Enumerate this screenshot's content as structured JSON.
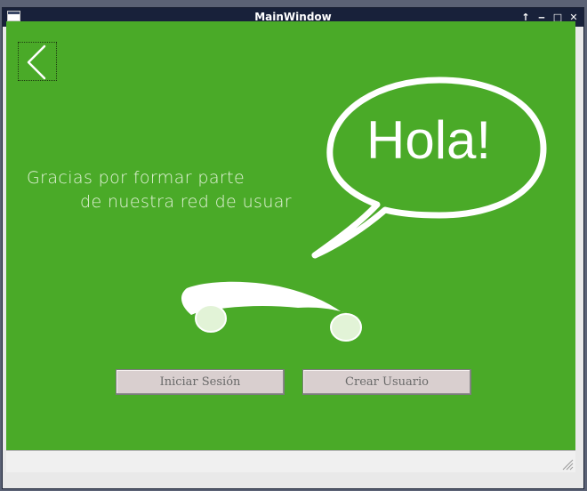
{
  "window": {
    "title": "MainWindow",
    "controls": {
      "shade": "↑",
      "minimize": "‒",
      "maximize": "□",
      "close": "✕"
    }
  },
  "content": {
    "background_color": "#4aaa28",
    "back_icon": "chevron-left-icon",
    "greeting": "Hola!",
    "message": {
      "line1": "Gracias por formar parte",
      "line2": "de nuestra red de usuar"
    },
    "illustration": "car-icon"
  },
  "actions": {
    "login_label": "Iniciar Sesión",
    "create_label": "Crear Usuario"
  }
}
